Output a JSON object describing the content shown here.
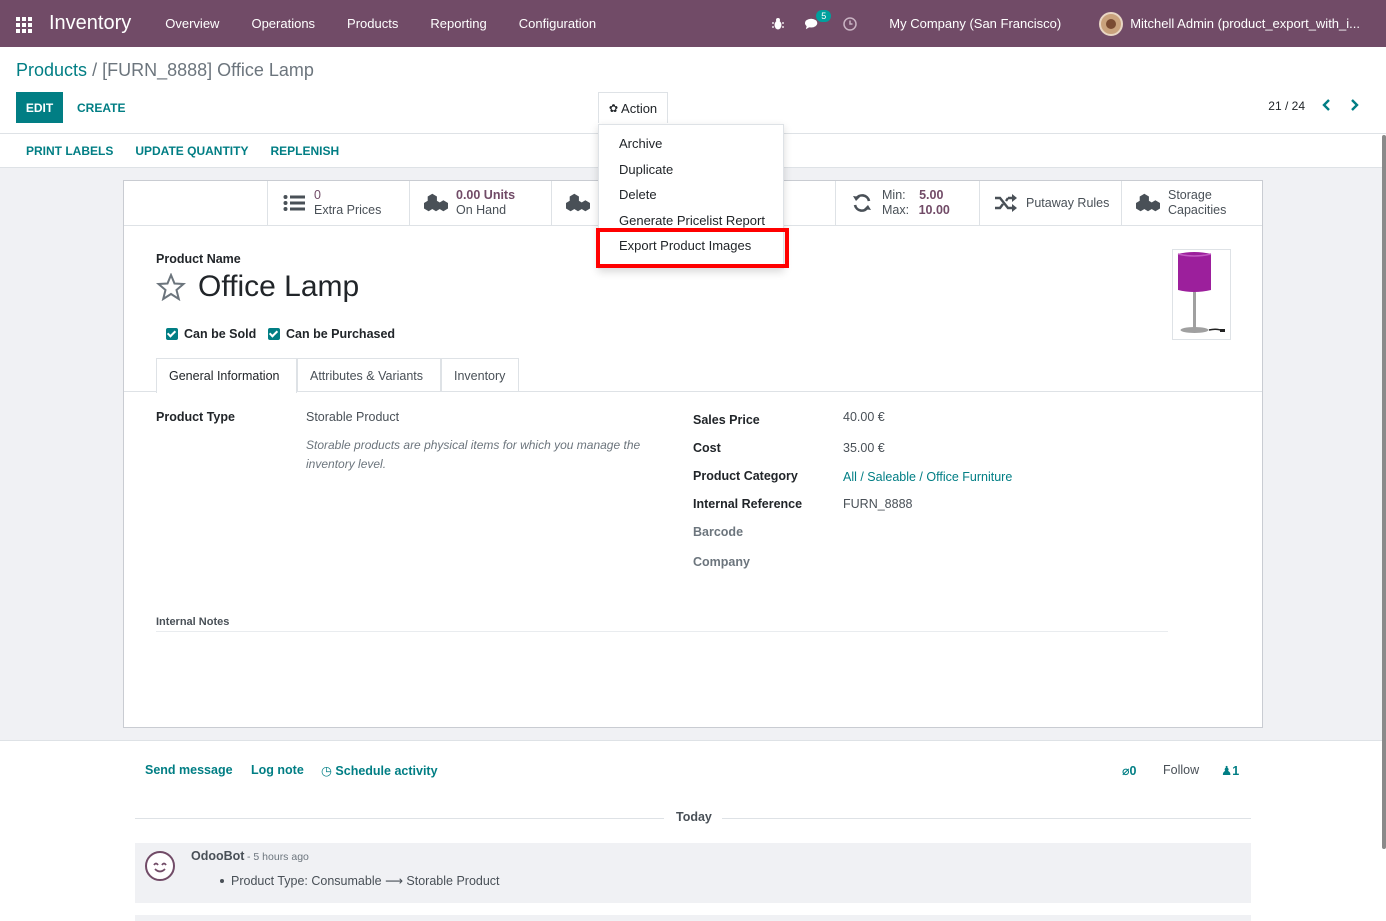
{
  "navbar": {
    "app_name": "Inventory",
    "menu": [
      "Overview",
      "Operations",
      "Products",
      "Reporting",
      "Configuration"
    ],
    "chat_badge": "5",
    "company": "My Company (San Francisco)",
    "user": "Mitchell Admin (product_export_with_i..."
  },
  "breadcrumb": {
    "parent": "Products",
    "separator": "/",
    "current": "[FURN_8888] Office Lamp"
  },
  "buttons": {
    "edit": "EDIT",
    "create": "CREATE",
    "action": "Action"
  },
  "pager": {
    "text": "21 / 24"
  },
  "statusbar": [
    "PRINT LABELS",
    "UPDATE QUANTITY",
    "REPLENISH"
  ],
  "action_menu": [
    "Archive",
    "Duplicate",
    "Delete",
    "Generate Pricelist Report",
    "Export Product Images"
  ],
  "smart_buttons": {
    "extra_prices": {
      "value": "0",
      "label": "Extra Prices"
    },
    "on_hand": {
      "value": "0.00 Units",
      "label": "On Hand"
    },
    "minmax": {
      "min_label": "Min:",
      "min_value": "5.00",
      "max_label": "Max:",
      "max_value": "10.00"
    },
    "putaway": {
      "label": "Putaway Rules"
    },
    "storage": {
      "line1": "Storage",
      "line2": "Capacities"
    }
  },
  "product": {
    "name_label": "Product Name",
    "name": "Office Lamp",
    "can_be_sold": "Can be Sold",
    "can_be_purchased": "Can be Purchased"
  },
  "tabs": [
    "General Information",
    "Attributes & Variants",
    "Inventory"
  ],
  "general": {
    "product_type_label": "Product Type",
    "product_type": "Storable Product",
    "help": "Storable products are physical items for which you manage the inventory level.",
    "sales_price_label": "Sales Price",
    "sales_price": "40.00 €",
    "cost_label": "Cost",
    "cost": "35.00 €",
    "category_label": "Product Category",
    "category": "All / Saleable / Office Furniture",
    "internal_ref_label": "Internal Reference",
    "internal_ref": "FURN_8888",
    "barcode_label": "Barcode",
    "company_label": "Company",
    "notes_label": "Internal Notes"
  },
  "chatter": {
    "send_message": "Send message",
    "log_note": "Log note",
    "schedule": "Schedule activity",
    "attachments": "0",
    "follow": "Follow",
    "followers": "1",
    "today": "Today",
    "message": {
      "author": "OdooBot",
      "time": "- 5 hours ago",
      "body": "Product Type: Consumable ⟶ Storable Product"
    }
  },
  "colors": {
    "brand": "#714b67",
    "accent": "#017e84",
    "highlight": "#ff0000"
  }
}
